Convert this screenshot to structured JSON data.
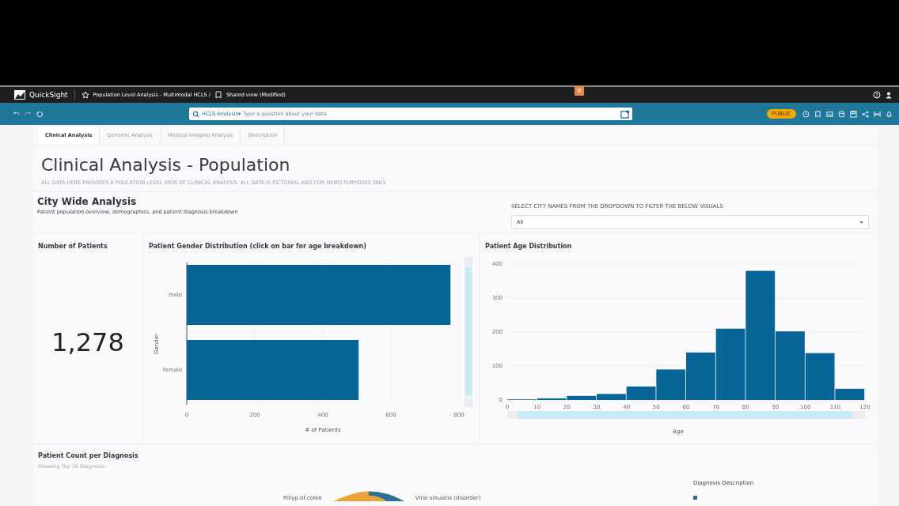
{
  "app": {
    "name": "QuickSight",
    "breadcrumb": "Population Level Analysis - Multimodal HCLS / ",
    "shared_view": "Shared view (Modified)"
  },
  "toolbar": {
    "analysis": "HCLS Analysis▾",
    "placeholder": "Type a question about your data",
    "badge": "PUBLIC"
  },
  "tabs": [
    {
      "label": "Clinical Analysis",
      "selected": true
    },
    {
      "label": "Genomic Analysis",
      "selected": false
    },
    {
      "label": "Medical Imaging Analysis",
      "selected": false
    },
    {
      "label": "Description",
      "selected": false
    }
  ],
  "header": {
    "title": "Clinical Analysis - Population",
    "subtitle": "ALL DATA HERE PROVIDES A POULATION LEVEL VIEW OF CLINICAL ANALYSIS. ALL DATA IS FICTIONAL AND FOR DEMO PURPOSES ONLY."
  },
  "city": {
    "title": "City Wide Analysis",
    "subtitle": "Patient population overview, demographics, and patient diagnosis breakdown",
    "filter_label": "SELECT CITY NAMES FROM THE DROPDOWN TO FILTER THE BELOW VISUALS",
    "filter_value": "All"
  },
  "kpi": {
    "title": "Number of Patients",
    "value": "1,278"
  },
  "gender": {
    "title": "Patient Gender Distribution (click on bar for age breakdown)",
    "chart_data": {
      "type": "bar",
      "orientation": "horizontal",
      "xlabel": "# of Patients",
      "ylabel": "Gender",
      "categories": [
        "male",
        "female"
      ],
      "values": [
        775,
        505
      ],
      "xlim": [
        0,
        800
      ],
      "xticks": [
        0,
        200,
        400,
        600,
        800
      ]
    }
  },
  "age": {
    "title": "Patient Age Distribution",
    "chart_data": {
      "type": "bar",
      "xlabel": "Age",
      "x": [
        5,
        15,
        25,
        35,
        45,
        55,
        65,
        75,
        85,
        95,
        105,
        115
      ],
      "values": [
        2,
        5,
        12,
        18,
        40,
        90,
        140,
        210,
        380,
        202,
        138,
        33
      ],
      "xlim": [
        0,
        120
      ],
      "ylim": [
        0,
        400
      ],
      "xticks": [
        0,
        10,
        20,
        30,
        40,
        50,
        60,
        70,
        80,
        90,
        100,
        110,
        120
      ],
      "yticks": [
        0,
        100,
        200,
        300,
        400
      ]
    }
  },
  "diagnosis": {
    "title": "Patient Count per Diagnosis",
    "subtitle": "Showing Top 20 Diagnosis",
    "legend_title": "Diagnosis Description",
    "labels": [
      "Polyp of colon",
      "Viral sinusitis (disorder)"
    ]
  }
}
